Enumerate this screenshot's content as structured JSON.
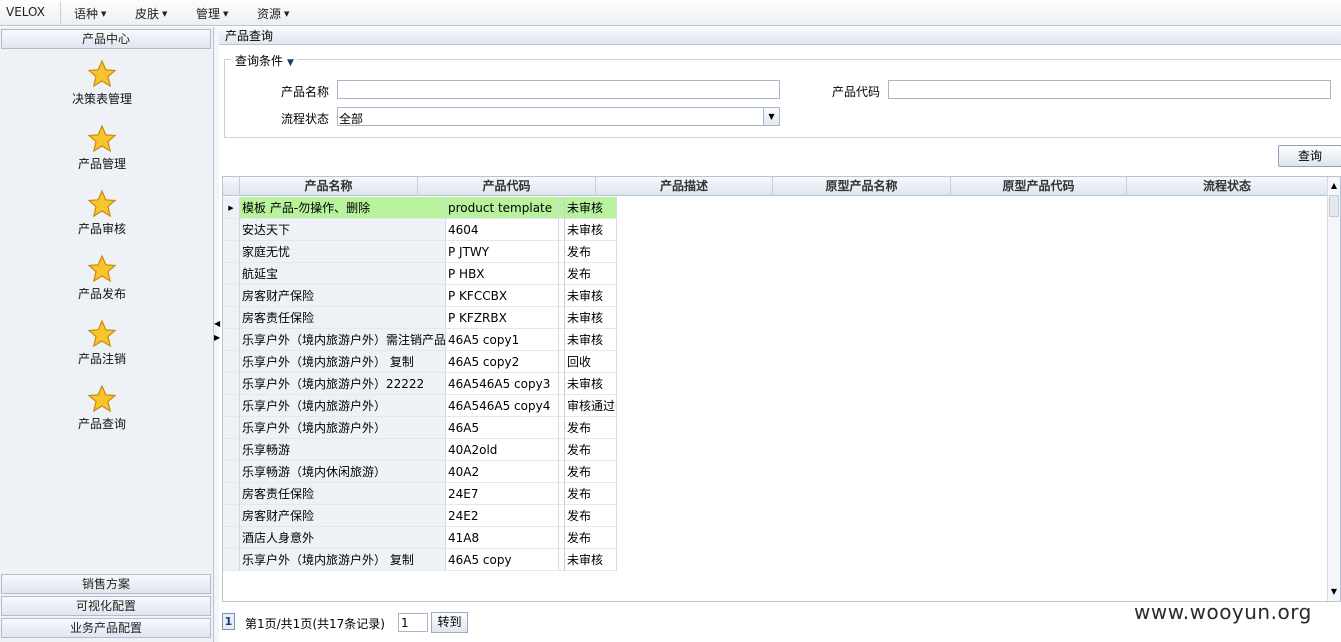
{
  "menubar": {
    "brand": "VELOX",
    "items": [
      {
        "label": "语种"
      },
      {
        "label": "皮肤"
      },
      {
        "label": "管理"
      },
      {
        "label": "资源"
      }
    ]
  },
  "sidebar": {
    "header": "产品中心",
    "items": [
      {
        "label": "决策表管理"
      },
      {
        "label": "产品管理"
      },
      {
        "label": "产品审核"
      },
      {
        "label": "产品发布"
      },
      {
        "label": "产品注销"
      },
      {
        "label": "产品查询"
      }
    ],
    "bottom_headers": [
      {
        "label": "销售方案"
      },
      {
        "label": "可视化配置"
      },
      {
        "label": "业务产品配置"
      }
    ]
  },
  "main": {
    "panel_title": "产品查询",
    "query": {
      "legend": "查询条件",
      "product_name_label": "产品名称",
      "product_name_value": "",
      "product_code_label": "产品代码",
      "product_code_value": "",
      "flow_status_label": "流程状态",
      "flow_status_value": "全部",
      "submit_label": "查询"
    },
    "grid": {
      "columns": [
        "产品名称",
        "产品代码",
        "产品描述",
        "原型产品名称",
        "原型产品代码",
        "流程状态"
      ],
      "rows": [
        {
          "name": "模板  产品-勿操作、删除",
          "code": "product  template",
          "status": "未审核",
          "selected": true
        },
        {
          "name": "安达天下",
          "code": "4604",
          "status": "未审核"
        },
        {
          "name": "家庭无忧",
          "code": "P  JTWY",
          "status": "发布"
        },
        {
          "name": "航延宝",
          "code": "P  HBX",
          "status": "发布"
        },
        {
          "name": "房客财产保险",
          "code": "P  KFCCBX",
          "status": "未审核"
        },
        {
          "name": "房客责任保险",
          "code": "P  KFZRBX",
          "status": "未审核"
        },
        {
          "name": "乐享户外（境内旅游户外）需注销产品",
          "code": "46A5  copy1",
          "status": "未审核"
        },
        {
          "name": "乐享户外（境内旅游户外）  复制",
          "code": "46A5  copy2",
          "status": "回收"
        },
        {
          "name": "乐享户外（境内旅游户外）22222",
          "code": "46A546A5  copy3",
          "status": "未审核"
        },
        {
          "name": "乐享户外（境内旅游户外）",
          "code": "46A546A5  copy4",
          "status": "审核通过"
        },
        {
          "name": "乐享户外（境内旅游户外）",
          "code": "46A5",
          "status": "发布"
        },
        {
          "name": "乐享畅游",
          "code": "40A2old",
          "status": "发布"
        },
        {
          "name": "乐享畅游（境内休闲旅游）",
          "code": "40A2",
          "status": "发布"
        },
        {
          "name": "房客责任保险",
          "code": "24E7",
          "status": "发布"
        },
        {
          "name": "房客财产保险",
          "code": "24E2",
          "status": "发布"
        },
        {
          "name": "酒店人身意外",
          "code": "41A8",
          "status": "发布"
        },
        {
          "name": "乐享户外（境内旅游户外）  复制",
          "code": "46A5  copy",
          "status": "未审核"
        }
      ],
      "selected_color": "#b9f29c"
    },
    "pager": {
      "current_page": "1",
      "info": "第1页/共1页(共17条记录)",
      "page_input": "1",
      "go_label": "转到"
    }
  },
  "watermark": "www.wooyun.org",
  "icons": {
    "nav": "star-icon",
    "caret": "caret-down-icon"
  }
}
